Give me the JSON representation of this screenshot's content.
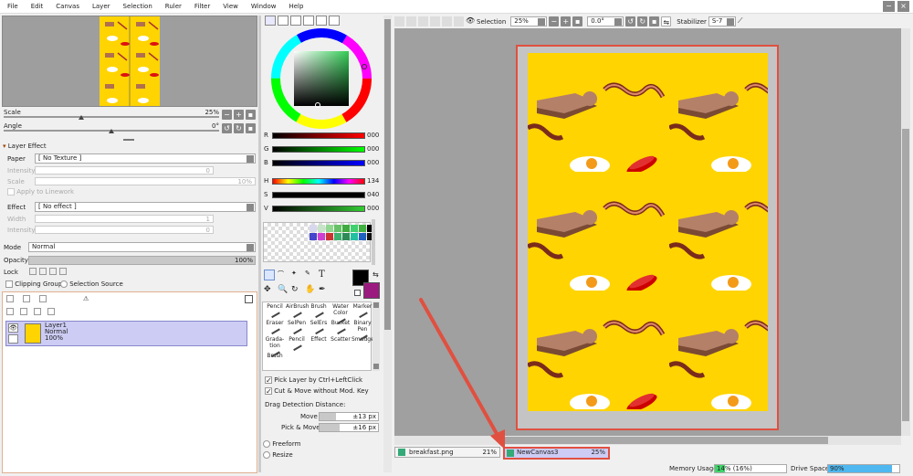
{
  "menu": [
    "File",
    "Edit",
    "Canvas",
    "Layer",
    "Selection",
    "Ruler",
    "Filter",
    "View",
    "Window",
    "Help"
  ],
  "navigator": {
    "scale_label": "Scale",
    "scale_value": "25%",
    "angle_label": "Angle",
    "angle_value": "0°"
  },
  "layer_effect": {
    "title": "Layer Effect",
    "paper_label": "Paper",
    "paper_value": "[ No Texture ]",
    "intensity_label": "Intensity",
    "intensity_value": "0",
    "scale_label": "Scale",
    "scale_value": "10%",
    "apply_linework": "Apply to Linework",
    "effect_label": "Effect",
    "effect_value": "[ No effect ]",
    "width_label": "Width",
    "width_value": "1",
    "intensity2_label": "Intensity",
    "intensity2_value": "0"
  },
  "layer_props": {
    "mode_label": "Mode",
    "mode_value": "Normal",
    "opacity_label": "Opacity",
    "opacity_value": "100%",
    "lock_label": "Lock",
    "clipping_group": "Clipping Group",
    "selection_source": "Selection Source"
  },
  "layers": [
    {
      "name": "Layer1",
      "mode": "Normal",
      "opacity": "100%"
    }
  ],
  "color": {
    "rgb": [
      {
        "label": "R",
        "value": "000"
      },
      {
        "label": "G",
        "value": "000"
      },
      {
        "label": "B",
        "value": "000"
      }
    ],
    "hsv": [
      {
        "label": "H",
        "value": "134"
      },
      {
        "label": "S",
        "value": "040"
      },
      {
        "label": "V",
        "value": "000"
      }
    ],
    "primary": "#000000",
    "secondary": "#9b1a7f"
  },
  "swatches": [
    "#d7d7ee",
    "#c8e4c8",
    "#90d890",
    "#66c266",
    "#3faa3f",
    "#40d070",
    "#40b040",
    "#000000",
    "#4444cc",
    "#d040d0",
    "#cc3333",
    "#3cb371",
    "#2e8b57",
    "#20c0a0",
    "#2060c0",
    "#111111"
  ],
  "tools": [
    {
      "name": "Pencil"
    },
    {
      "name": "AirBrush"
    },
    {
      "name": "Brush"
    },
    {
      "name": "Water Color"
    },
    {
      "name": "Marker"
    },
    {
      "name": "Eraser"
    },
    {
      "name": "SelPen"
    },
    {
      "name": "SelErs"
    },
    {
      "name": "Bucket"
    },
    {
      "name": "Binary Pen"
    },
    {
      "name": "Grada-tion"
    },
    {
      "name": "Pencil"
    },
    {
      "name": "Effect"
    },
    {
      "name": "Scatter"
    },
    {
      "name": "Smudge"
    },
    {
      "name": "Brush"
    }
  ],
  "tool_options": {
    "pick_layer": "Pick Layer by Ctrl+LeftClick",
    "cut_move": "Cut & Move without Mod. Key",
    "drag_title": "Drag Detection Distance:",
    "move_label": "Move",
    "move_value": "±13 px",
    "pickmove_label": "Pick & Move",
    "pickmove_value": "±16 px",
    "freeform": "Freeform",
    "resize": "Resize"
  },
  "toolbar": {
    "selection_label": "Selection",
    "zoom_value": "25%",
    "angle_value": "0.0°",
    "stabilizer_label": "Stabilizer",
    "stabilizer_value": "S-7"
  },
  "tabs": [
    {
      "name": "breakfast.png",
      "zoom": "21%"
    },
    {
      "name": "NewCanvas3",
      "zoom": "25%"
    }
  ],
  "status": {
    "memory_label": "Memory Usage",
    "memory_value": "14% (16%)",
    "memory_fill": 0.14,
    "drive_label": "Drive Space",
    "drive_value": "90%",
    "drive_fill": 0.9
  }
}
